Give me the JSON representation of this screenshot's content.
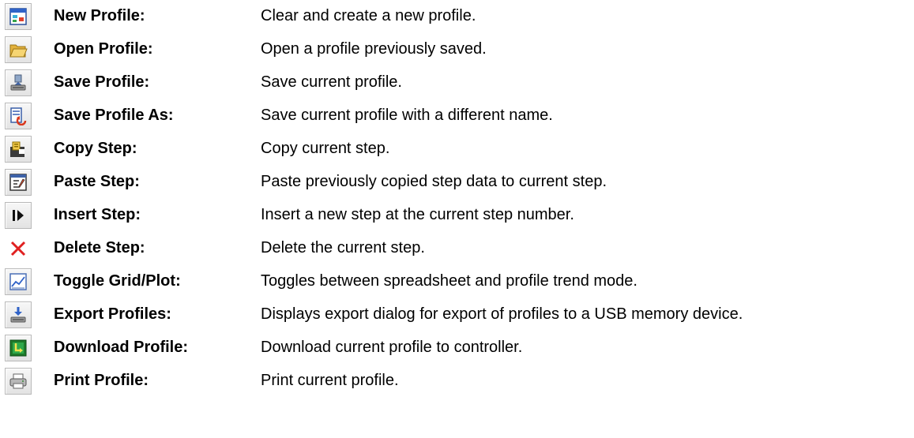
{
  "items": [
    {
      "icon": "new-profile-icon",
      "name": "New Profile:",
      "description": "Clear and create a new profile."
    },
    {
      "icon": "open-folder-icon",
      "name": "Open Profile:",
      "description": "Open a profile previously saved."
    },
    {
      "icon": "save-icon",
      "name": "Save Profile:",
      "description": "Save current profile."
    },
    {
      "icon": "save-as-icon",
      "name": "Save Profile As:",
      "description": "Save current profile with a different name."
    },
    {
      "icon": "copy-step-icon",
      "name": "Copy Step:",
      "description": "Copy current step."
    },
    {
      "icon": "paste-step-icon",
      "name": "Paste Step:",
      "description": "Paste previously copied step data to current step."
    },
    {
      "icon": "insert-step-icon",
      "name": "Insert Step:",
      "description": "Insert a new step at the current step number."
    },
    {
      "icon": "delete-step-icon",
      "name": "Delete Step:",
      "description": "Delete the current step."
    },
    {
      "icon": "toggle-plot-icon",
      "name": "Toggle Grid/Plot:",
      "description": "Toggles between spreadsheet and profile trend mode."
    },
    {
      "icon": "export-icon",
      "name": "Export Profiles:",
      "description": "Displays export dialog for export of profiles to a USB memory device."
    },
    {
      "icon": "download-icon",
      "name": "Download Profile:",
      "description": "Download current profile to controller."
    },
    {
      "icon": "print-icon",
      "name": "Print Profile:",
      "description": "Print current profile."
    }
  ]
}
